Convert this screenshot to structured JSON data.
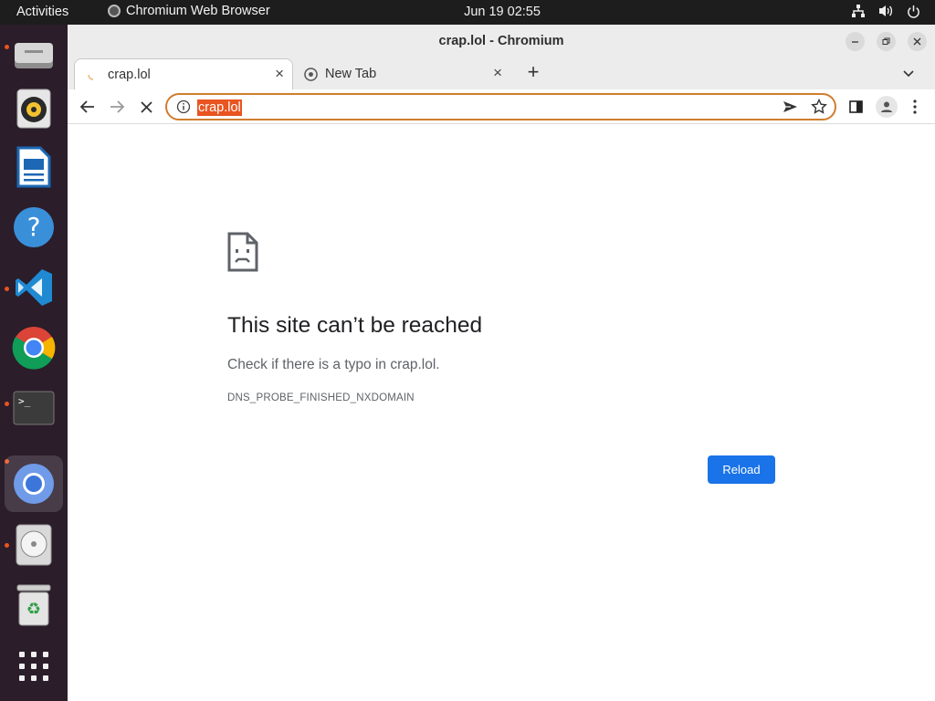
{
  "topbar": {
    "activities": "Activities",
    "app_name": "Chromium Web Browser",
    "clock": "Jun 19  02:55",
    "tray_icons": [
      "network-icon",
      "volume-icon",
      "power-icon"
    ]
  },
  "dock": {
    "items": [
      {
        "name": "files",
        "icon": "drive-icon",
        "running": true
      },
      {
        "name": "rhythmbox",
        "icon": "speaker-icon",
        "running": false
      },
      {
        "name": "writer",
        "icon": "document-icon",
        "running": false
      },
      {
        "name": "help",
        "icon": "help-icon",
        "running": false
      },
      {
        "name": "vscode",
        "icon": "vscode-icon",
        "running": true
      },
      {
        "name": "chrome",
        "icon": "chrome-icon",
        "running": false
      },
      {
        "name": "terminal",
        "icon": "terminal-icon",
        "running": true
      },
      {
        "name": "chromium",
        "icon": "chromium-icon",
        "running": true,
        "active": true
      },
      {
        "name": "disk",
        "icon": "disc-icon",
        "running": true
      },
      {
        "name": "trash",
        "icon": "trash-icon",
        "running": false
      },
      {
        "name": "app-grid",
        "icon": "grid-icon",
        "running": false
      }
    ]
  },
  "window": {
    "title": "crap.lol - Chromium"
  },
  "tabs": [
    {
      "label": "crap.lol",
      "active": true,
      "loading": true
    },
    {
      "label": "New Tab",
      "active": false,
      "loading": false
    }
  ],
  "toolbar": {
    "url": "crap.lol"
  },
  "error": {
    "title": "This site can’t be reached",
    "message": "Check if there is a typo in crap.lol.",
    "code": "DNS_PROBE_FINISHED_NXDOMAIN",
    "reload_label": "Reload"
  },
  "colors": {
    "accent": "#e95420",
    "dock_bg": "#2b1d2a",
    "topbar_bg": "#1d1d1d",
    "reload_button": "#1a73e8",
    "url_focus_border": "#d07d2f"
  }
}
